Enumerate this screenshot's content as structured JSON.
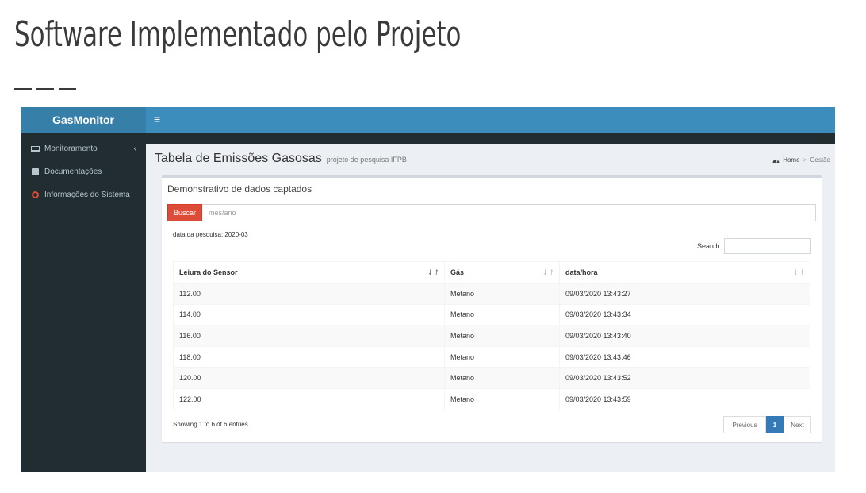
{
  "slide": {
    "title": "Software Implementado pelo Projeto"
  },
  "app": {
    "brand": "GasMonitor",
    "hamburger_icon": "≡",
    "sidebar": {
      "items": [
        {
          "label": "Monitoramento",
          "icon": "monitor-icon",
          "has_chevron": true
        },
        {
          "label": "Documentações",
          "icon": "book-icon"
        },
        {
          "label": "Informações do Sistema",
          "icon": "circle-icon",
          "icon_color": "#dd4b39"
        }
      ],
      "chevron": "‹"
    },
    "header": {
      "title": "Tabela de Emissões Gasosas",
      "subtitle": "projeto de pesquisa IFPB"
    },
    "breadcrumb": {
      "home": "Home",
      "separator": ">",
      "current": "Gestão"
    },
    "box": {
      "title": "Demonstrativo de dados captados",
      "search_button": "Buscar",
      "input_placeholder": "mes/ano",
      "search_date_text": "data da pesquisa: 2020-03",
      "search_label": "Search:"
    },
    "table": {
      "columns": [
        "Leiura do Sensor",
        "Gás",
        "data/hora"
      ],
      "rows": [
        [
          "112.00",
          "Metano",
          "09/03/2020 13:43:27"
        ],
        [
          "114.00",
          "Metano",
          "09/03/2020 13:43:34"
        ],
        [
          "116.00",
          "Metano",
          "09/03/2020 13:43:40"
        ],
        [
          "118.00",
          "Metano",
          "09/03/2020 13:43:46"
        ],
        [
          "120.00",
          "Metano",
          "09/03/2020 13:43:52"
        ],
        [
          "122.00",
          "Metano",
          "09/03/2020 13:43:59"
        ]
      ],
      "info": "Showing 1 to 6 of 6 entries"
    },
    "pagination": {
      "previous": "Previous",
      "current": "1",
      "next": "Next"
    },
    "colors": {
      "topbar": "#3c8dbc",
      "logo_bg": "#367fa9",
      "sidebar_bg": "#222d32",
      "button_red": "#dd4b39",
      "page_active": "#337ab7"
    }
  }
}
